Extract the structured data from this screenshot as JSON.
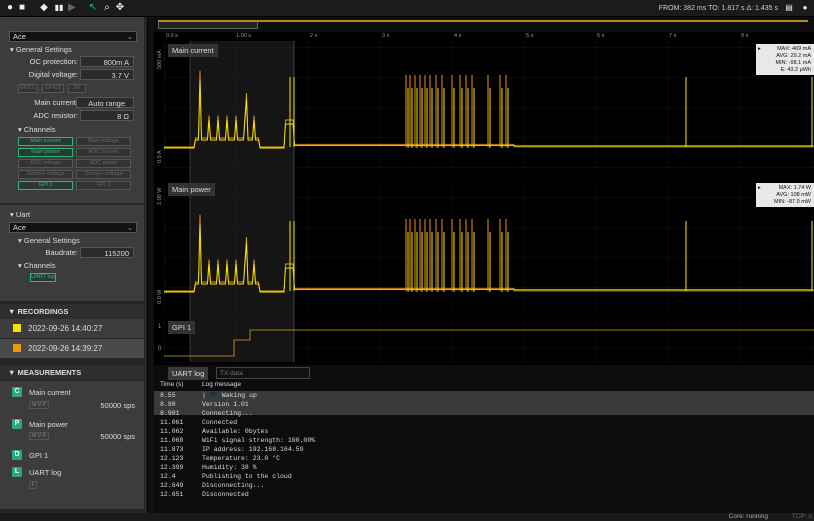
{
  "toolbar": {
    "record_icon": "record-icon",
    "stop_icon": "stop-icon",
    "stat": "FROM: 382 ms  TO: 1.817 s  Δ: 1.435 s"
  },
  "sidebar": {
    "device_select": "Ace",
    "general_settings": "General Settings",
    "oc_label": "OC protection:",
    "oc_value": "800m A",
    "dv_label": "Digital voltage:",
    "dv_value": "3.7 V",
    "gpio_buttons": [
      "GPIO1",
      "GPIO2",
      "5V"
    ],
    "mc_label": "Main current:",
    "mc_value": "Auto range",
    "adc_label": "ADC resistor:",
    "adc_value": "8 Ω",
    "channels": "Channels",
    "channel_buttons": [
      "Main current",
      "Main voltage",
      "Main power",
      "ADC current",
      "ADC voltage",
      "ADC power",
      "Sense+ voltage",
      "Sense+ voltage",
      "GPI 1",
      "GPI 2"
    ],
    "uart": "Uart",
    "uart_select": "Ace",
    "uart_general": "General Settings",
    "baud_label": "Baudrate:",
    "baud_value": "115200",
    "uart_channels": "Channels",
    "uart_log_btn": "UART log",
    "recordings_title": "RECORDINGS",
    "recordings": [
      {
        "label": "2022-09-26 14:40:27",
        "color": "#f2e600"
      },
      {
        "label": "2022-09-26 14:39:27",
        "color": "#f0950c"
      }
    ],
    "measurements_title": "MEASUREMENTS",
    "measurements": [
      {
        "icon": "C",
        "label": "Main current",
        "badge": "M V P",
        "sps": "50000 sps",
        "color": "#2aa87a"
      },
      {
        "icon": "P",
        "label": "Main power",
        "badge": "M V P",
        "sps": "50000 sps",
        "color": "#2aa87a"
      },
      {
        "icon": "D",
        "label": "GPI 1",
        "badge": "",
        "sps": "",
        "color": "#2aa87a"
      },
      {
        "icon": "L",
        "label": "UART log",
        "badge": "F",
        "sps": "",
        "color": "#2aa87a"
      }
    ]
  },
  "plot": {
    "ticks": [
      "0.0 s",
      "1.00 s",
      "2 s",
      "3 s",
      "4 s",
      "5 s",
      "6 s",
      "7 s",
      "8 s"
    ],
    "ch1": {
      "title": "Main current",
      "ytop": "500 mA",
      "ybot": "0.0 A",
      "info": [
        "MAX: 469 mA",
        "AVG: 29.2 mA",
        "MIN: -98.1 mA",
        "E: 43.2 µWh"
      ]
    },
    "ch2": {
      "title": "Main power",
      "ytop": "2.00 W",
      "ybot": "0.0 W",
      "info": [
        "MAX: 1.74 W",
        "AVG: 108 mW",
        "MIN: -87.9 mW"
      ]
    },
    "ch3": {
      "title": "GPI 1",
      "y1": "1",
      "y0": "0"
    }
  },
  "log": {
    "tab": "UART log",
    "tx_placeholder": "TX data",
    "col_time": "Time (s)",
    "col_msg": "Log message",
    "rows": [
      [
        "8.55",
        "| 🌑 Waking up"
      ],
      [
        "8.98",
        "Version 1.01"
      ],
      [
        "8.981",
        "Connecting..."
      ],
      [
        "11.061",
        "Connected"
      ],
      [
        "11.062",
        "Available: 0bytes"
      ],
      [
        "11.068",
        "WiFi signal strength: 100.00%"
      ],
      [
        "11.873",
        "IP address: 192.168.164.59"
      ],
      [
        "12.123",
        "Temperature: 23.0 °C"
      ],
      [
        "12.399",
        "Humidity: 38 %"
      ],
      [
        "12.4",
        "Publishing to the cloud"
      ],
      [
        "12.649",
        "Disconnecting..."
      ],
      [
        "12.651",
        "Disconnected"
      ]
    ]
  },
  "footer": {
    "status": "Core: running",
    "tcp": "TCP: o"
  }
}
